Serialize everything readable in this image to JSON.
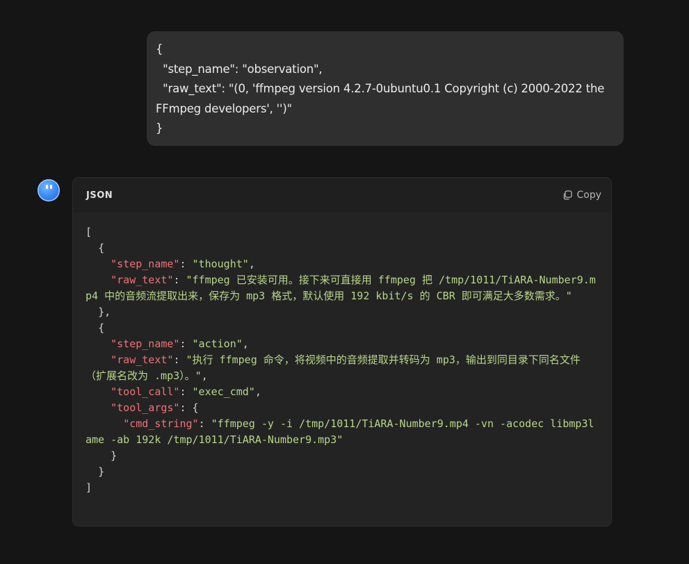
{
  "user_message": {
    "lines": [
      "{",
      "  \"step_name\": \"observation\",",
      "  \"raw_text\": \"(0, 'ffmpeg version 4.2.7-0ubuntu0.1 Copyright (c) 2000-2022 the FFmpeg developers', '')\"",
      "}"
    ]
  },
  "assistant": {
    "avatar_icon": "assistant-face-icon",
    "code_block": {
      "language_label": "JSON",
      "copy_label": "Copy",
      "tokens": {
        "open_bracket": "[",
        "open_brace_1": "{",
        "k_step_name_1": "\"step_name\"",
        "v_step_name_1": "\"thought\"",
        "k_raw_text_1": "\"raw_text\"",
        "v_raw_text_1": "\"ffmpeg 已安装可用。接下来可直接用 ffmpeg 把 /tmp/1011/TiARA-Number9.mp4 中的音频流提取出来，保存为 mp3 格式，默认使用 192 kbit/s 的 CBR 即可满足大多数需求。\"",
        "close_brace_1": "},",
        "open_brace_2": "{",
        "k_step_name_2": "\"step_name\"",
        "v_step_name_2": "\"action\"",
        "k_raw_text_2": "\"raw_text\"",
        "v_raw_text_2": "\"执行 ffmpeg 命令，将视频中的音频提取并转码为 mp3，输出到同目录下同名文件（扩展名改为 .mp3）。\"",
        "k_tool_call": "\"tool_call\"",
        "v_tool_call": "\"exec_cmd\"",
        "k_tool_args": "\"tool_args\"",
        "k_cmd_string": "\"cmd_string\"",
        "v_cmd_string": "\"ffmpeg -y -i /tmp/1011/TiARA-Number9.mp4 -vn -acodec libmp3lame -ab 192k /tmp/1011/TiARA-Number9.mp3\"",
        "close_tool_args": "}",
        "close_brace_2": "}",
        "close_bracket": "]"
      }
    }
  },
  "colors": {
    "background": "#151515",
    "bubble": "#2f2f2f",
    "code_bg": "#232323",
    "key": "#f07178",
    "string": "#b8d68a",
    "avatar": "#3d8cf5"
  }
}
